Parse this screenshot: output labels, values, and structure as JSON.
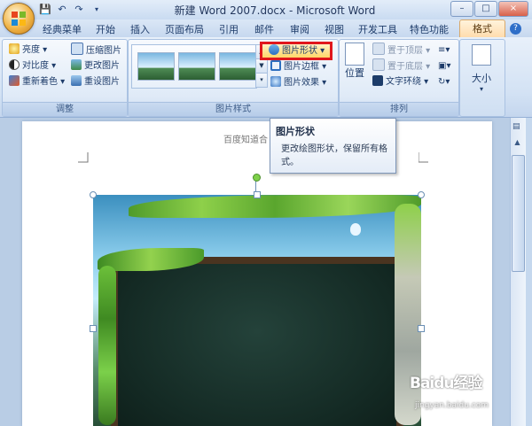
{
  "title_bar": {
    "title": "新建 Word 2007.docx - Microsoft Word",
    "qat_icons": [
      "save-icon",
      "undo-icon",
      "redo-icon",
      "dropdown-icon"
    ],
    "window_buttons": [
      "–",
      "□",
      "×"
    ]
  },
  "tabs": [
    "经典菜单",
    "开始",
    "插入",
    "页面布局",
    "引用",
    "邮件",
    "审阅",
    "视图",
    "开发工具",
    "特色功能",
    "格式"
  ],
  "active_tab": "格式",
  "ribbon": {
    "adjust": {
      "label": "调整",
      "items": [
        "亮度 ▾",
        "对比度 ▾",
        "重新着色 ▾",
        "压缩图片",
        "更改图片",
        "重设图片"
      ]
    },
    "picture_styles": {
      "label": "图片样式",
      "items": [
        "图片形状 ▾",
        "图片边框 ▾",
        "图片效果 ▾"
      ]
    },
    "arrange": {
      "label": "排列",
      "position": "位置",
      "items": [
        "置于顶层 ▾",
        "置于底层 ▾",
        "文字环绕 ▾"
      ]
    },
    "size": {
      "label": "大小"
    }
  },
  "tooltip": {
    "title": "图片形状",
    "description": "更改绘图形状，保留所有格式。"
  },
  "document": {
    "header_text": "百度知道合"
  },
  "watermark": {
    "text": "Baidu经验",
    "url": "jingyan.baidu.com"
  },
  "colors": {
    "highlight_border": "#e0171c",
    "format_tab": "#ffd9a6",
    "ribbon": "#dfeaf7"
  }
}
